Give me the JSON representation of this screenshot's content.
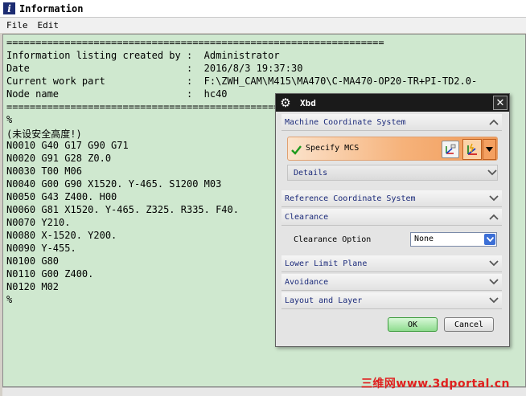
{
  "window": {
    "title": "Information",
    "menus": [
      "File",
      "Edit"
    ]
  },
  "listing": {
    "lines": [
      "=================================================================",
      "Information listing created by :  Administrator",
      "Date                           :  2016/8/3 19:37:30",
      "Current work part              :  F:\\ZWH_CAM\\M415\\MA470\\C-MA470-OP20-TR+PI-TD2.0-",
      "Node name                      :  hc40",
      "=================================================================",
      "%",
      "(未设安全高度!)",
      "N0010 G40 G17 G90 G71",
      "N0020 G91 G28 Z0.0",
      "N0030 T00 M06",
      "N0040 G00 G90 X1520. Y-465. S1200 M03",
      "N0050 G43 Z400. H00",
      "N0060 G81 X1520. Y-465. Z325. R335. F40.",
      "N0070 Y210.",
      "N0080 X-1520. Y200.",
      "N0090 Y-455.",
      "N0100 G80",
      "N0110 G00 Z400.",
      "N0120 M02",
      "%"
    ]
  },
  "dialog": {
    "title": "Xbd",
    "sections": {
      "machine_cs": "Machine Coordinate System",
      "specify_mcs": "Specify MCS",
      "details": "Details",
      "reference_cs": "Reference Coordinate System",
      "clearance": "Clearance",
      "clearance_option_label": "Clearance Option",
      "clearance_option_value": "None",
      "lower_limit_plane": "Lower Limit Plane",
      "avoidance": "Avoidance",
      "layout_and_layer": "Layout and Layer"
    },
    "buttons": {
      "ok": "OK",
      "cancel": "Cancel"
    }
  },
  "watermark": "三维网www.3dportal.cn",
  "colors": {
    "listing_background": "#cfe8cf",
    "dialog_title_bar": "#1a1a1a",
    "section_label": "#1b2a7a",
    "mcs_highlight": "#f09a58",
    "ok_button": "#8fdc8f",
    "watermark": "#e02020"
  },
  "icons": {
    "window": "info-icon",
    "dialog": "gear-icon",
    "close": "close-icon",
    "check": "checkmark-icon"
  }
}
